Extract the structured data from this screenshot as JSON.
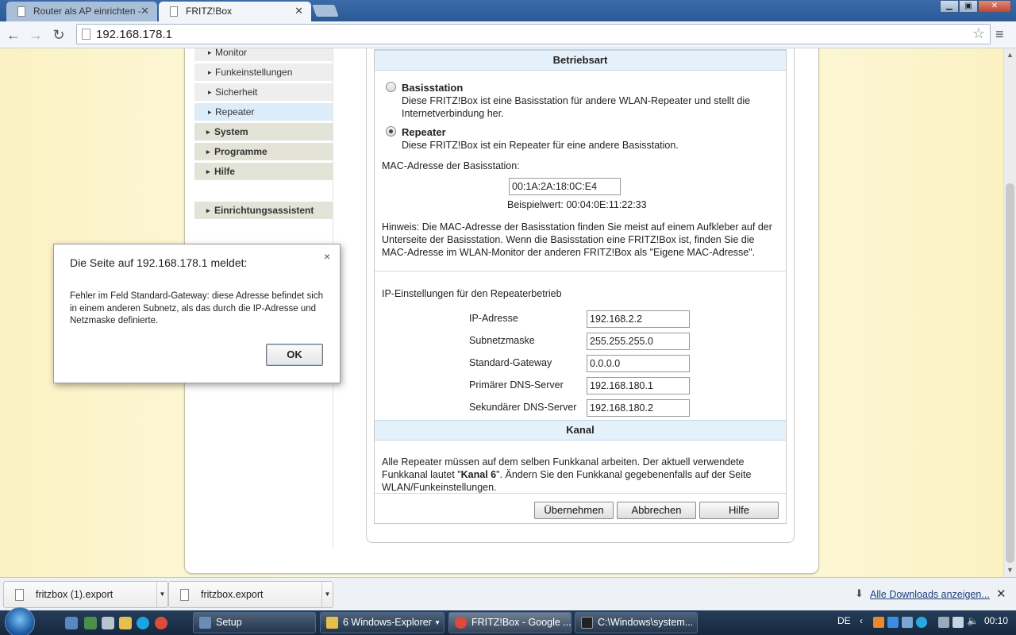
{
  "browser": {
    "tabs": [
      {
        "title": "Router als AP einrichten -"
      },
      {
        "title": "FRITZ!Box"
      }
    ],
    "url": "192.168.178.1",
    "window_controls": {
      "minimize": "▁",
      "maximize": "▣",
      "close": "✕"
    }
  },
  "nav": {
    "sub_items": [
      {
        "label": "Monitor"
      },
      {
        "label": "Funkeinstellungen"
      },
      {
        "label": "Sicherheit"
      },
      {
        "label": "Repeater"
      }
    ],
    "main_items": [
      {
        "label": "System"
      },
      {
        "label": "Programme"
      },
      {
        "label": "Hilfe"
      }
    ],
    "wizard": {
      "label": "Einrichtungsassistent"
    }
  },
  "betriebsart": {
    "heading": "Betriebsart",
    "options": [
      {
        "title": "Basisstation",
        "description": "Diese FRITZ!Box ist eine Basisstation für andere WLAN-Repeater und stellt die Internetverbindung her.",
        "selected": false
      },
      {
        "title": "Repeater",
        "description": "Diese FRITZ!Box ist ein Repeater für eine andere Basisstation.",
        "selected": true
      }
    ],
    "mac_label": "MAC-Adresse der Basisstation:",
    "mac_value": "00:1A:2A:18:0C:E4",
    "example": "Beispielwert: 00:04:0E:11:22:33",
    "hint": "Hinweis: Die MAC-Adresse der Basisstation finden Sie meist auf einem Aufkleber auf der Unterseite der Basisstation. Wenn die Basisstation eine FRITZ!Box ist, finden Sie die MAC-Adresse im WLAN-Monitor der anderen FRITZ!Box als \"Eigene MAC-Adresse\"."
  },
  "ip_settings": {
    "heading": "IP-Einstellungen für den Repeaterbetrieb",
    "fields": [
      {
        "label": "IP-Adresse",
        "value": "192.168.2.2"
      },
      {
        "label": "Subnetzmaske",
        "value": "255.255.255.0"
      },
      {
        "label": "Standard-Gateway",
        "value": "0.0.0.0"
      },
      {
        "label": "Primärer DNS-Server",
        "value": "192.168.180.1"
      },
      {
        "label": "Sekundärer DNS-Server",
        "value": "192.168.180.2"
      }
    ]
  },
  "kanal": {
    "heading": "Kanal",
    "text_before": "Alle Repeater müssen auf dem selben Funkkanal arbeiten. Der aktuell verwendete Funkkanal lautet \"",
    "channel": "Kanal 6",
    "text_after": "\". Ändern Sie den Funkkanal gegebenenfalls auf der Seite WLAN/Funkeinstellungen."
  },
  "buttons": {
    "apply": "Übernehmen",
    "cancel": "Abbrechen",
    "help": "Hilfe"
  },
  "dialog": {
    "title": "Die Seite auf 192.168.178.1 meldet:",
    "message": "Fehler im Feld Standard-Gateway: diese Adresse befindet sich in einem anderen Subnetz, als das durch die IP-Adresse und Netzmaske definierte.",
    "ok": "OK",
    "close": "×"
  },
  "downloads": {
    "items": [
      {
        "name": "fritzbox (1).export"
      },
      {
        "name": "fritzbox.export"
      }
    ],
    "show_all": "Alle Downloads anzeigen..."
  },
  "taskbar": {
    "tasks": [
      {
        "label": "Setup"
      },
      {
        "label": "6 Windows-Explorer"
      },
      {
        "label": "FRITZ!Box - Google ..."
      },
      {
        "label": "C:\\Windows\\system..."
      }
    ],
    "language": "DE",
    "clock": "00:10"
  }
}
